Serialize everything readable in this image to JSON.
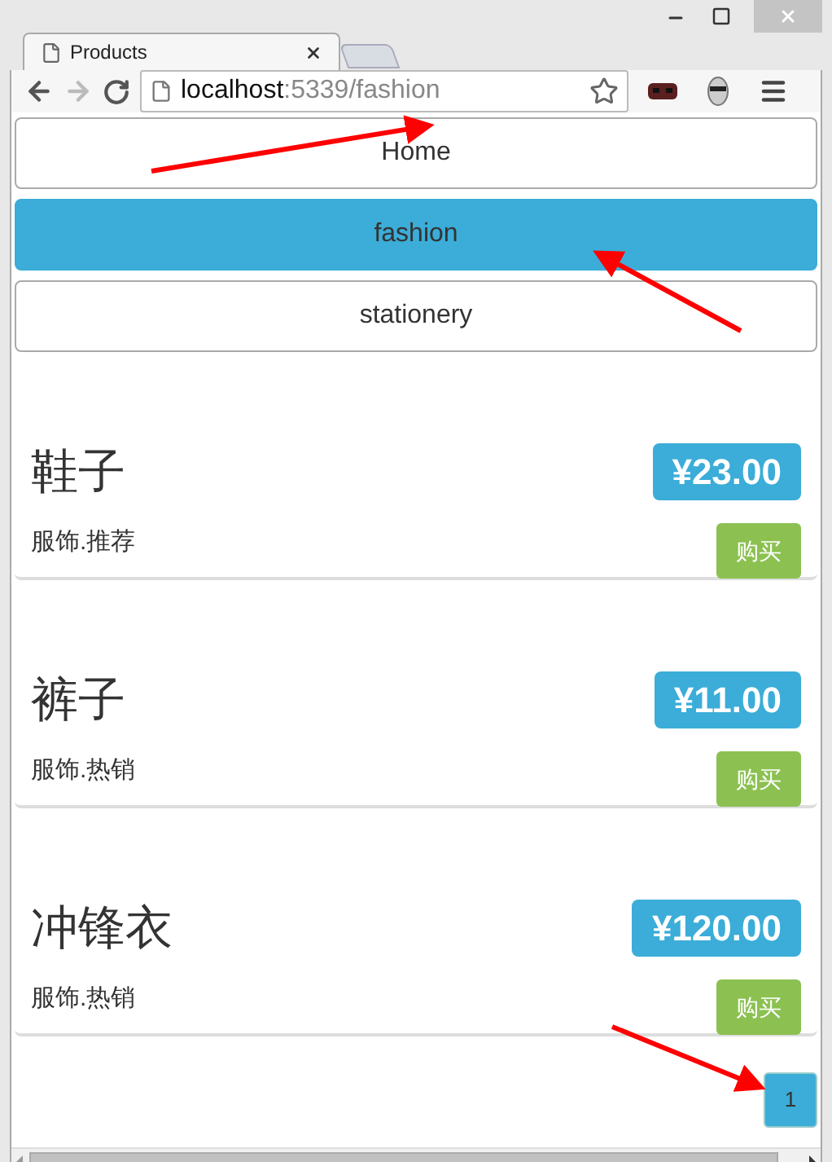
{
  "browser": {
    "tab_title": "Products",
    "url_host": "localhost",
    "url_path": ":5339/fashion"
  },
  "categories": [
    {
      "label": "Home",
      "selected": false
    },
    {
      "label": "fashion",
      "selected": true
    },
    {
      "label": "stationery",
      "selected": false
    }
  ],
  "products": [
    {
      "name": "鞋子",
      "price": "¥23.00",
      "tags": "服饰.推荐",
      "action": "购买"
    },
    {
      "name": "裤子",
      "price": "¥11.00",
      "tags": "服饰.热销",
      "action": "购买"
    },
    {
      "name": "冲锋衣",
      "price": "¥120.00",
      "tags": "服饰.热销",
      "action": "购买"
    }
  ],
  "pagination": [
    {
      "label": "1",
      "selected": true
    }
  ]
}
